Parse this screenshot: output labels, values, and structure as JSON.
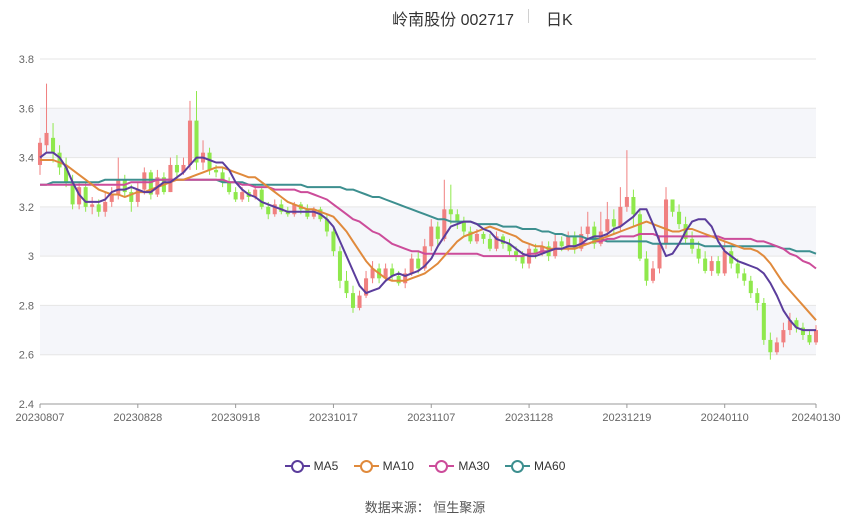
{
  "header": {
    "name_code": "岭南股份 002717",
    "period": "日K"
  },
  "footer": {
    "source": "数据来源：  恒生聚源"
  },
  "colors": {
    "up": "#f08080",
    "down": "#8fe84c",
    "ma5": "#5b3d9c",
    "ma10": "#e08a3c",
    "ma30": "#cc4c9a",
    "ma60": "#3d8f8f"
  },
  "chart_data": {
    "type": "candlestick",
    "title": "岭南股份 002717 日K",
    "ylim": [
      2.4,
      3.8
    ],
    "y_ticks": [
      "2.4",
      "2.6",
      "2.8",
      "3",
      "3.2",
      "3.4",
      "3.6",
      "3.8"
    ],
    "x_ticks": [
      {
        "label": "20230807",
        "index": 0
      },
      {
        "label": "20230828",
        "index": 15
      },
      {
        "label": "20230918",
        "index": 30
      },
      {
        "label": "20231017",
        "index": 45
      },
      {
        "label": "20231107",
        "index": 60
      },
      {
        "label": "20231128",
        "index": 75
      },
      {
        "label": "20231219",
        "index": 90
      },
      {
        "label": "20240110",
        "index": 105
      },
      {
        "label": "20240130",
        "index": 119
      }
    ],
    "legend": [
      "MA5",
      "MA10",
      "MA30",
      "MA60"
    ],
    "candles": [
      [
        3.37,
        3.46,
        3.48,
        3.33
      ],
      [
        3.45,
        3.5,
        3.7,
        3.42
      ],
      [
        3.48,
        3.42,
        3.54,
        3.38
      ],
      [
        3.42,
        3.36,
        3.45,
        3.33
      ],
      [
        3.36,
        3.3,
        3.4,
        3.28
      ],
      [
        3.3,
        3.21,
        3.33,
        3.19
      ],
      [
        3.21,
        3.28,
        3.3,
        3.19
      ],
      [
        3.28,
        3.2,
        3.3,
        3.18
      ],
      [
        3.2,
        3.21,
        3.24,
        3.17
      ],
      [
        3.21,
        3.18,
        3.23,
        3.16
      ],
      [
        3.18,
        3.22,
        3.26,
        3.16
      ],
      [
        3.22,
        3.25,
        3.28,
        3.2
      ],
      [
        3.25,
        3.31,
        3.4,
        3.23
      ],
      [
        3.31,
        3.26,
        3.33,
        3.24
      ],
      [
        3.26,
        3.22,
        3.29,
        3.18
      ],
      [
        3.22,
        3.27,
        3.3,
        3.2
      ],
      [
        3.27,
        3.34,
        3.36,
        3.25
      ],
      [
        3.34,
        3.25,
        3.35,
        3.23
      ],
      [
        3.25,
        3.32,
        3.35,
        3.24
      ],
      [
        3.32,
        3.26,
        3.34,
        3.25
      ],
      [
        3.26,
        3.37,
        3.4,
        3.26
      ],
      [
        3.37,
        3.34,
        3.41,
        3.31
      ],
      [
        3.34,
        3.37,
        3.4,
        3.33
      ],
      [
        3.37,
        3.55,
        3.63,
        3.35
      ],
      [
        3.55,
        3.38,
        3.67,
        3.35
      ],
      [
        3.38,
        3.42,
        3.47,
        3.35
      ],
      [
        3.42,
        3.35,
        3.44,
        3.33
      ],
      [
        3.35,
        3.34,
        3.37,
        3.32
      ],
      [
        3.34,
        3.3,
        3.36,
        3.28
      ],
      [
        3.3,
        3.26,
        3.32,
        3.25
      ],
      [
        3.26,
        3.23,
        3.28,
        3.22
      ],
      [
        3.23,
        3.26,
        3.28,
        3.22
      ],
      [
        3.26,
        3.24,
        3.27,
        3.22
      ],
      [
        3.24,
        3.27,
        3.29,
        3.23
      ],
      [
        3.27,
        3.2,
        3.28,
        3.19
      ],
      [
        3.2,
        3.17,
        3.22,
        3.15
      ],
      [
        3.17,
        3.21,
        3.23,
        3.16
      ],
      [
        3.21,
        3.18,
        3.23,
        3.17
      ],
      [
        3.18,
        3.17,
        3.2,
        3.16
      ],
      [
        3.17,
        3.21,
        3.22,
        3.16
      ],
      [
        3.21,
        3.19,
        3.22,
        3.17
      ],
      [
        3.19,
        3.16,
        3.21,
        3.15
      ],
      [
        3.16,
        3.19,
        3.2,
        3.15
      ],
      [
        3.19,
        3.15,
        3.2,
        3.14
      ],
      [
        3.15,
        3.1,
        3.17,
        3.08
      ],
      [
        3.1,
        3.02,
        3.12,
        3.0
      ],
      [
        3.02,
        2.9,
        3.04,
        2.87
      ],
      [
        2.9,
        2.85,
        2.94,
        2.83
      ],
      [
        2.85,
        2.79,
        2.88,
        2.77
      ],
      [
        2.79,
        2.84,
        2.86,
        2.78
      ],
      [
        2.84,
        2.91,
        2.94,
        2.83
      ],
      [
        2.91,
        2.95,
        2.98,
        2.89
      ],
      [
        2.95,
        2.91,
        2.97,
        2.89
      ],
      [
        2.91,
        2.95,
        2.97,
        2.9
      ],
      [
        2.95,
        2.92,
        2.97,
        2.9
      ],
      [
        2.92,
        2.89,
        2.94,
        2.88
      ],
      [
        2.89,
        2.93,
        2.95,
        2.87
      ],
      [
        2.93,
        2.99,
        3.01,
        2.92
      ],
      [
        2.99,
        2.95,
        3.02,
        2.93
      ],
      [
        2.95,
        3.04,
        3.07,
        2.94
      ],
      [
        3.04,
        3.12,
        3.15,
        3.02
      ],
      [
        3.12,
        3.07,
        3.14,
        3.04
      ],
      [
        3.07,
        3.19,
        3.31,
        3.06
      ],
      [
        3.19,
        3.17,
        3.29,
        3.13
      ],
      [
        3.17,
        3.14,
        3.19,
        3.11
      ],
      [
        3.14,
        3.1,
        3.16,
        3.08
      ],
      [
        3.1,
        3.06,
        3.12,
        3.05
      ],
      [
        3.06,
        3.09,
        3.11,
        3.05
      ],
      [
        3.09,
        3.07,
        3.1,
        3.05
      ],
      [
        3.07,
        3.03,
        3.09,
        3.02
      ],
      [
        3.03,
        3.08,
        3.1,
        3.02
      ],
      [
        3.08,
        3.05,
        3.09,
        3.03
      ],
      [
        3.05,
        3.02,
        3.07,
        3.0
      ],
      [
        3.02,
        3.0,
        3.04,
        2.98
      ],
      [
        3.0,
        2.97,
        3.02,
        2.95
      ],
      [
        2.97,
        3.03,
        3.05,
        2.95
      ],
      [
        3.03,
        3.01,
        3.05,
        2.99
      ],
      [
        3.01,
        3.04,
        3.06,
        3.0
      ],
      [
        3.04,
        3.0,
        3.06,
        2.98
      ],
      [
        3.0,
        3.06,
        3.09,
        2.99
      ],
      [
        3.06,
        3.04,
        3.08,
        3.02
      ],
      [
        3.04,
        3.08,
        3.1,
        3.02
      ],
      [
        3.08,
        3.03,
        3.1,
        3.01
      ],
      [
        3.03,
        3.09,
        3.12,
        3.02
      ],
      [
        3.09,
        3.12,
        3.18,
        3.07
      ],
      [
        3.12,
        3.05,
        3.14,
        3.03
      ],
      [
        3.05,
        3.1,
        3.18,
        3.04
      ],
      [
        3.1,
        3.15,
        3.22,
        3.08
      ],
      [
        3.15,
        3.12,
        3.19,
        3.09
      ],
      [
        3.12,
        3.2,
        3.28,
        3.1
      ],
      [
        3.2,
        3.24,
        3.43,
        3.18
      ],
      [
        3.24,
        3.17,
        3.27,
        3.12
      ],
      [
        3.17,
        2.99,
        3.19,
        2.98
      ],
      [
        2.99,
        2.9,
        3.02,
        2.88
      ],
      [
        2.9,
        2.95,
        2.98,
        2.89
      ],
      [
        2.95,
        3.05,
        3.08,
        2.93
      ],
      [
        3.05,
        3.23,
        3.28,
        3.03
      ],
      [
        3.23,
        3.18,
        3.22,
        3.16
      ],
      [
        3.18,
        3.13,
        3.21,
        3.11
      ],
      [
        3.13,
        3.07,
        3.16,
        3.05
      ],
      [
        3.07,
        3.03,
        3.1,
        3.01
      ],
      [
        3.03,
        2.99,
        3.06,
        2.97
      ],
      [
        2.99,
        2.94,
        3.02,
        2.93
      ],
      [
        2.94,
        2.98,
        3.0,
        2.92
      ],
      [
        2.98,
        2.93,
        3.0,
        2.92
      ],
      [
        2.93,
        3.02,
        3.06,
        2.92
      ],
      [
        3.02,
        2.97,
        3.04,
        2.95
      ],
      [
        2.97,
        2.93,
        2.99,
        2.91
      ],
      [
        2.93,
        2.9,
        2.95,
        2.88
      ],
      [
        2.9,
        2.85,
        2.92,
        2.83
      ],
      [
        2.85,
        2.81,
        2.87,
        2.78
      ],
      [
        2.81,
        2.66,
        2.83,
        2.64
      ],
      [
        2.66,
        2.61,
        2.69,
        2.58
      ],
      [
        2.61,
        2.65,
        2.67,
        2.6
      ],
      [
        2.65,
        2.7,
        2.73,
        2.63
      ],
      [
        2.7,
        2.74,
        2.77,
        2.68
      ],
      [
        2.74,
        2.71,
        2.75,
        2.69
      ],
      [
        2.71,
        2.68,
        2.73,
        2.66
      ],
      [
        2.68,
        2.65,
        2.7,
        2.64
      ],
      [
        2.65,
        2.7,
        2.72,
        2.64
      ]
    ],
    "ma5": [
      3.4,
      3.42,
      3.42,
      3.4,
      3.36,
      3.3,
      3.25,
      3.22,
      3.22,
      3.22,
      3.23,
      3.26,
      3.27,
      3.27,
      3.28,
      3.27,
      3.26,
      3.26,
      3.28,
      3.3,
      3.3,
      3.32,
      3.34,
      3.37,
      3.4,
      3.4,
      3.39,
      3.38,
      3.38,
      3.35,
      3.3,
      3.27,
      3.25,
      3.24,
      3.22,
      3.21,
      3.2,
      3.19,
      3.18,
      3.18,
      3.18,
      3.18,
      3.18,
      3.17,
      3.15,
      3.12,
      3.06,
      3.0,
      2.94,
      2.88,
      2.85,
      2.86,
      2.87,
      2.9,
      2.92,
      2.93,
      2.92,
      2.93,
      2.94,
      2.96,
      2.99,
      3.04,
      3.08,
      3.12,
      3.13,
      3.14,
      3.14,
      3.13,
      3.11,
      3.1,
      3.07,
      3.06,
      3.05,
      3.03,
      3.01,
      3.0,
      3.0,
      3.01,
      3.02,
      3.03,
      3.03,
      3.04,
      3.04,
      3.05,
      3.07,
      3.08,
      3.08,
      3.09,
      3.11,
      3.12,
      3.14,
      3.16,
      3.19,
      3.19,
      3.13,
      3.06,
      3.0,
      3.01,
      3.05,
      3.1,
      3.14,
      3.15,
      3.15,
      3.12,
      3.06,
      3.02,
      3.0,
      2.98,
      2.97,
      2.96,
      2.95,
      2.93,
      2.89,
      2.84,
      2.78,
      2.74,
      2.71,
      2.7,
      2.7,
      2.7
    ],
    "ma10": [
      3.39,
      3.39,
      3.39,
      3.38,
      3.37,
      3.35,
      3.33,
      3.31,
      3.29,
      3.27,
      3.26,
      3.25,
      3.25,
      3.24,
      3.25,
      3.26,
      3.26,
      3.27,
      3.28,
      3.29,
      3.3,
      3.31,
      3.31,
      3.32,
      3.33,
      3.34,
      3.35,
      3.36,
      3.36,
      3.35,
      3.34,
      3.33,
      3.32,
      3.32,
      3.3,
      3.28,
      3.26,
      3.24,
      3.22,
      3.21,
      3.2,
      3.19,
      3.19,
      3.18,
      3.17,
      3.16,
      3.13,
      3.1,
      3.06,
      3.02,
      2.98,
      2.95,
      2.93,
      2.91,
      2.9,
      2.9,
      2.9,
      2.91,
      2.92,
      2.93,
      2.95,
      2.97,
      3.0,
      3.03,
      3.06,
      3.08,
      3.09,
      3.1,
      3.11,
      3.12,
      3.11,
      3.1,
      3.09,
      3.08,
      3.06,
      3.05,
      3.04,
      3.04,
      3.03,
      3.03,
      3.03,
      3.03,
      3.03,
      3.04,
      3.05,
      3.06,
      3.07,
      3.08,
      3.09,
      3.1,
      3.11,
      3.12,
      3.13,
      3.14,
      3.13,
      3.12,
      3.11,
      3.1,
      3.1,
      3.11,
      3.11,
      3.1,
      3.09,
      3.08,
      3.07,
      3.06,
      3.05,
      3.04,
      3.03,
      3.03,
      3.02,
      3.0,
      2.97,
      2.93,
      2.89,
      2.86,
      2.83,
      2.8,
      2.77,
      2.74
    ],
    "ma30": [
      3.29,
      3.29,
      3.29,
      3.29,
      3.29,
      3.29,
      3.29,
      3.29,
      3.29,
      3.29,
      3.29,
      3.29,
      3.29,
      3.29,
      3.3,
      3.3,
      3.3,
      3.3,
      3.31,
      3.31,
      3.31,
      3.31,
      3.31,
      3.31,
      3.31,
      3.31,
      3.31,
      3.31,
      3.31,
      3.3,
      3.3,
      3.29,
      3.29,
      3.28,
      3.28,
      3.28,
      3.27,
      3.27,
      3.27,
      3.27,
      3.26,
      3.26,
      3.25,
      3.24,
      3.23,
      3.21,
      3.19,
      3.17,
      3.15,
      3.14,
      3.12,
      3.1,
      3.09,
      3.07,
      3.05,
      3.04,
      3.03,
      3.02,
      3.02,
      3.01,
      3.01,
      3.01,
      3.01,
      3.01,
      3.01,
      3.01,
      3.01,
      3.01,
      3.0,
      3.0,
      3.0,
      3.0,
      3.0,
      3.0,
      3.0,
      3.01,
      3.01,
      3.02,
      3.02,
      3.03,
      3.03,
      3.04,
      3.04,
      3.05,
      3.05,
      3.06,
      3.06,
      3.07,
      3.07,
      3.08,
      3.08,
      3.08,
      3.09,
      3.09,
      3.09,
      3.08,
      3.08,
      3.08,
      3.08,
      3.08,
      3.08,
      3.08,
      3.08,
      3.08,
      3.08,
      3.07,
      3.07,
      3.07,
      3.07,
      3.07,
      3.06,
      3.06,
      3.05,
      3.04,
      3.03,
      3.01,
      3.0,
      2.98,
      2.97,
      2.95
    ],
    "ma60": [
      3.29,
      3.29,
      3.3,
      3.3,
      3.3,
      3.3,
      3.3,
      3.3,
      3.3,
      3.3,
      3.31,
      3.31,
      3.31,
      3.31,
      3.31,
      3.31,
      3.31,
      3.31,
      3.31,
      3.31,
      3.31,
      3.31,
      3.31,
      3.31,
      3.31,
      3.31,
      3.31,
      3.31,
      3.3,
      3.3,
      3.3,
      3.3,
      3.29,
      3.29,
      3.29,
      3.29,
      3.29,
      3.29,
      3.29,
      3.29,
      3.29,
      3.28,
      3.28,
      3.28,
      3.28,
      3.28,
      3.28,
      3.27,
      3.27,
      3.26,
      3.25,
      3.24,
      3.24,
      3.23,
      3.22,
      3.21,
      3.2,
      3.19,
      3.18,
      3.17,
      3.16,
      3.15,
      3.15,
      3.14,
      3.14,
      3.14,
      3.14,
      3.13,
      3.13,
      3.13,
      3.13,
      3.12,
      3.12,
      3.12,
      3.11,
      3.11,
      3.11,
      3.1,
      3.1,
      3.09,
      3.09,
      3.08,
      3.08,
      3.08,
      3.07,
      3.07,
      3.07,
      3.06,
      3.06,
      3.06,
      3.06,
      3.06,
      3.06,
      3.06,
      3.05,
      3.05,
      3.05,
      3.05,
      3.05,
      3.05,
      3.05,
      3.05,
      3.04,
      3.04,
      3.04,
      3.04,
      3.04,
      3.04,
      3.04,
      3.04,
      3.04,
      3.04,
      3.04,
      3.04,
      3.03,
      3.03,
      3.02,
      3.02,
      3.02,
      3.01
    ]
  }
}
